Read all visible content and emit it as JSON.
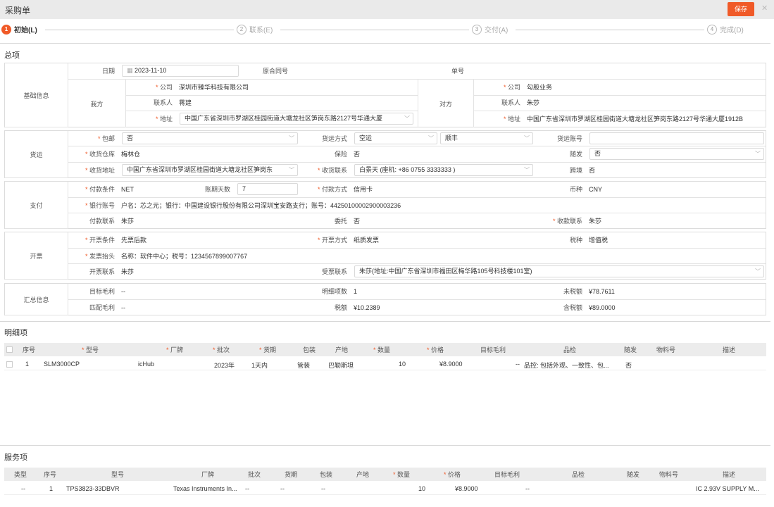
{
  "window": {
    "title": "采购单",
    "save_label": "保存",
    "close": "✕"
  },
  "steps": [
    {
      "num": "1",
      "label": "初始(L)"
    },
    {
      "num": "2",
      "label": "联系(E)"
    },
    {
      "num": "3",
      "label": "交付(A)"
    },
    {
      "num": "4",
      "label": "完成(D)"
    }
  ],
  "general": {
    "section_title": "总项",
    "basic": {
      "group": "基础信息",
      "date_label": "日期",
      "date_value": "2023-11-10",
      "contract_label": "原合同号",
      "contract_value": "",
      "order_label": "单号",
      "order_value": "",
      "ours": {
        "group": "我方",
        "company_label": "公司",
        "company": "深圳市臻华科技有限公司",
        "contact_label": "联系人",
        "contact": "蒋建",
        "address_label": "地址",
        "address": "中国广东省深圳市罗湖区桂园街道大塘龙社区笋岗东路2127号华通大厦"
      },
      "theirs": {
        "group": "对方",
        "company_label": "公司",
        "company": "勾股业务",
        "contact_label": "联系人",
        "contact": "朱莎",
        "address_label": "地址",
        "address": "中国广东省深圳市罗湖区桂园街道大塘龙社区笋岗东路2127号华通大厦1912B"
      }
    },
    "shipping": {
      "group": "货运",
      "free_label": "包邮",
      "free": "否",
      "method_label": "货运方式",
      "method": "空运",
      "carrier": "顺丰",
      "account_label": "货运账号",
      "account": "",
      "warehouse_label": "收货仓库",
      "warehouse": "梅林仓",
      "insurance_label": "保险",
      "insurance": "否",
      "follow_label": "随发",
      "follow": "否",
      "address_label": "收货地址",
      "address": "中国广东省深圳市罗湖区桂园街道大塘龙社区笋岗东",
      "contact_label": "收货联系",
      "contact": "白景天 (座机: +86 0755 3333333 )",
      "cross_label": "跨境",
      "cross": "否"
    },
    "payment": {
      "group": "支付",
      "terms_label": "付款条件",
      "terms": "NET",
      "days_label": "账期天数",
      "days": "7",
      "method_label": "付款方式",
      "method": "信用卡",
      "currency_label": "币种",
      "currency": "CNY",
      "bank_label": "银行账号",
      "bank": "户名：芯之元；银行：中国建设银行股份有限公司深圳宝安路支行；账号：44250100002900003236",
      "contact_label": "付款联系",
      "contact": "朱莎",
      "entrust_label": "委托",
      "entrust": "否",
      "receiver_label": "收款联系",
      "receiver": "朱莎"
    },
    "invoice": {
      "group": "开票",
      "terms_label": "开票条件",
      "terms": "先票后款",
      "method_label": "开票方式",
      "method": "纸质发票",
      "tax_label": "税种",
      "tax": "增值税",
      "header_label": "发票抬头",
      "header": "名称：软件中心；税号：1234567899007767",
      "contact_label": "开票联系",
      "contact": "朱莎",
      "receiver_label": "受票联系",
      "receiver": "朱莎(地址:中国广东省深圳市福田区梅华路105号科技楼101室)"
    },
    "summary": {
      "group": "汇总信息",
      "target_label": "目标毛利",
      "target": "--",
      "count_label": "明细项数",
      "count": "1",
      "pretax_label": "未税额",
      "pretax": "¥78.7611",
      "match_label": "匹配毛利",
      "match": "--",
      "tax_label": "税额",
      "tax": "¥10.2389",
      "total_label": "含税额",
      "total": "¥89.0000"
    }
  },
  "details": {
    "section_title": "明细项",
    "columns": [
      "序号",
      "型号",
      "厂牌",
      "批次",
      "货期",
      "包装",
      "产地",
      "数量",
      "价格",
      "目标毛利",
      "品检",
      "随发",
      "物料号",
      "描述"
    ],
    "rows": [
      {
        "seq": "1",
        "model": "SLM3000CP",
        "brand": "icHub",
        "batch": "2023年",
        "lead": "1天内",
        "pack": "管装",
        "origin": "巴勒斯坦",
        "qty": "10",
        "price": "¥8.9000",
        "margin": "--",
        "qc": "品控: 包括外观、一致性、包...",
        "follow": "否",
        "material": "",
        "desc": ""
      }
    ]
  },
  "services": {
    "section_title": "服务项",
    "columns": [
      "类型",
      "序号",
      "型号",
      "厂牌",
      "批次",
      "货期",
      "包装",
      "产地",
      "数量",
      "价格",
      "目标毛利",
      "品检",
      "随发",
      "物料号",
      "描述"
    ],
    "rows": [
      {
        "type": "--",
        "seq": "1",
        "model": "TPS3823-33DBVR",
        "brand": "Texas Instruments In...",
        "batch": "--",
        "lead": "--",
        "pack": "--",
        "origin": "",
        "qty": "10",
        "price": "¥8.9000",
        "margin": "--",
        "qc": "",
        "follow": "",
        "material": "",
        "desc": "IC 2.93V SUPPLY M..."
      }
    ]
  }
}
